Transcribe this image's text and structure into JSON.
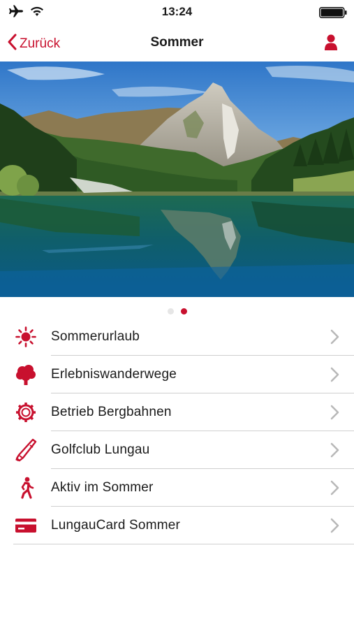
{
  "status_bar": {
    "time": "13:24",
    "icons": [
      "airplane-icon",
      "wifi-icon",
      "battery-icon"
    ]
  },
  "nav": {
    "back_label": "Zurück",
    "title": "Sommer",
    "profile_icon": "person-icon"
  },
  "carousel": {
    "page_count": 2,
    "current_page": 2,
    "image": "mountain-lake-photo"
  },
  "menu": {
    "items": [
      {
        "label": "Sommerurlaub",
        "icon": "sun-icon"
      },
      {
        "label": "Erlebniswanderwege",
        "icon": "tree-icon"
      },
      {
        "label": "Betrieb Bergbahnen",
        "icon": "gear-icon"
      },
      {
        "label": "Golfclub Lungau",
        "icon": "golf-club-icon"
      },
      {
        "label": "Aktiv im Sommer",
        "icon": "walking-person-icon"
      },
      {
        "label": "LungauCard Sommer",
        "icon": "card-icon"
      }
    ]
  },
  "colors": {
    "accent": "#c8102e",
    "separator": "#cfcfcf",
    "chevron": "#b8b8b8"
  }
}
